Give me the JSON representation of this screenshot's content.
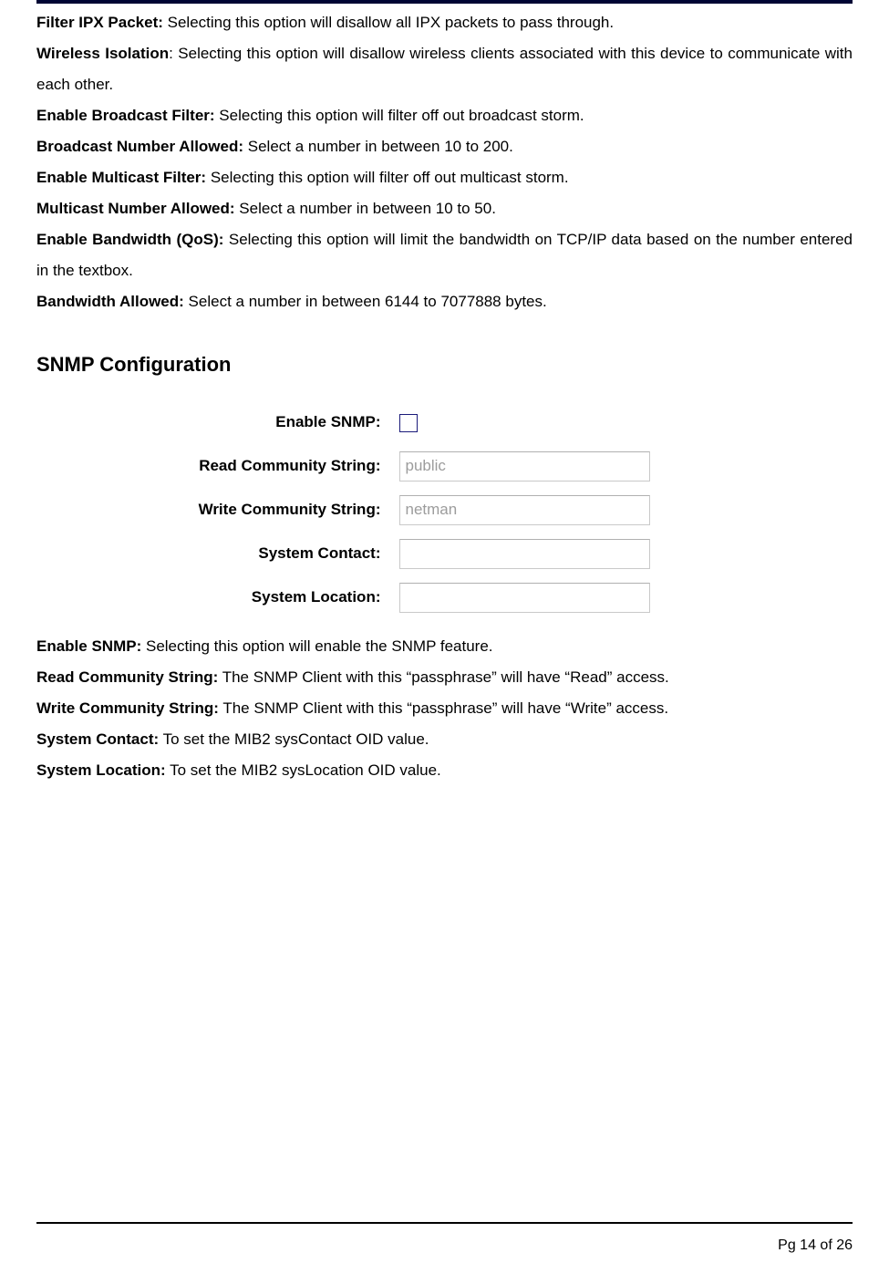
{
  "definitions": [
    {
      "term": "Filter IPX Packet:",
      "sep": " ",
      "desc": "Selecting this option will disallow all IPX packets to pass through.",
      "justify": false
    },
    {
      "term": "Wireless Isolation",
      "sep": ": ",
      "desc": "Selecting this option will disallow wireless clients associated with this device to communicate with each other.",
      "justify": true
    },
    {
      "term": "Enable Broadcast Filter:",
      "sep": " ",
      "desc": "Selecting this option will filter off out broadcast storm.",
      "justify": false
    },
    {
      "term": "Broadcast Number Allowed:",
      "sep": " ",
      "desc": "Select a number in between 10 to 200.",
      "justify": false
    },
    {
      "term": "Enable Multicast Filter:",
      "sep": " ",
      "desc": "Selecting this option will filter off out multicast storm.",
      "justify": false
    },
    {
      "term": "Multicast Number Allowed:",
      "sep": " ",
      "desc": "Select a number in between 10 to 50.",
      "justify": false
    },
    {
      "term": "Enable Bandwidth (QoS):",
      "sep": " ",
      "desc": "Selecting this option will limit the bandwidth on TCP/IP data based on the number entered in the textbox.",
      "justify": true
    },
    {
      "term": "Bandwidth Allowed:",
      "sep": " ",
      "desc": "Select a number in between 6144 to 7077888 bytes.",
      "justify": false
    }
  ],
  "section_heading": "SNMP Configuration",
  "snmp_form": {
    "rows": [
      {
        "label": "Enable SNMP:",
        "type": "checkbox",
        "checked": false
      },
      {
        "label": "Read Community String:",
        "type": "text",
        "value": "public",
        "disabled": true
      },
      {
        "label": "Write Community String:",
        "type": "text",
        "value": "netman",
        "disabled": true
      },
      {
        "label": "System Contact:",
        "type": "text",
        "value": "",
        "disabled": false
      },
      {
        "label": "System Location:",
        "type": "text",
        "value": "",
        "disabled": false
      }
    ]
  },
  "snmp_definitions": [
    {
      "term": "Enable SNMP:",
      "sep": "  ",
      "desc": "Selecting this option will enable the SNMP feature."
    },
    {
      "term": "Read Community String:",
      "sep": "  ",
      "desc": "The SNMP Client with this “passphrase” will have “Read” access."
    },
    {
      "term": "Write Community String:",
      "sep": "  ",
      "desc": "The SNMP Client with this “passphrase” will have “Write” access."
    },
    {
      "term": "System Contact:",
      "sep": "   ",
      "desc": "To set the MIB2  sysContact OID value."
    },
    {
      "term": "System Location:",
      "sep": "   ",
      "desc": "To set the MIB2 sysLocation OID value."
    }
  ],
  "footer": "Pg 14 of 26"
}
